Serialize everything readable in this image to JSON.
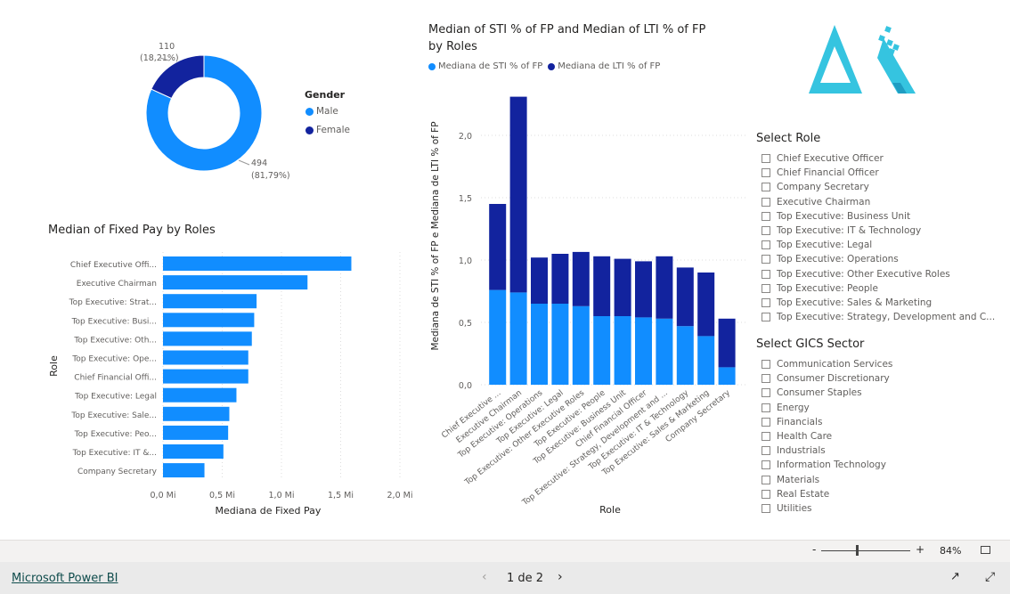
{
  "colors": {
    "sti": "#118dff",
    "lti": "#12239e",
    "male": "#118dff",
    "female": "#12239e",
    "logo": "#35c4e0"
  },
  "donut": {
    "legend_title": "Gender",
    "slices": [
      {
        "label": "Male",
        "value": 494,
        "pct_label": "494",
        "pct_sub": "(81,79%)",
        "pct": 81.79
      },
      {
        "label": "Female",
        "value": 110,
        "pct_label": "110",
        "pct_sub": "(18,21%)",
        "pct": 18.21
      }
    ]
  },
  "chart_data": [
    {
      "type": "bar",
      "orientation": "horizontal",
      "title": "Median of Fixed Pay by Roles",
      "xlabel": "Mediana de Fixed Pay",
      "ylabel": "Role",
      "xlim": [
        0,
        2.0
      ],
      "xticks": [
        "0,0 Mi",
        "0,5 Mi",
        "1,0 Mi",
        "1,5 Mi",
        "2,0 Mi"
      ],
      "categories": [
        "Chief Executive Offi...",
        "Executive Chairman",
        "Top Executive: Strat...",
        "Top Executive: Busi...",
        "Top Executive: Oth...",
        "Top Executive: Ope...",
        "Chief Financial Offi...",
        "Top Executive: Legal",
        "Top Executive: Sale...",
        "Top Executive: Peo...",
        "Top Executive: IT &...",
        "Company Secretary"
      ],
      "values": [
        1.59,
        1.22,
        0.79,
        0.77,
        0.75,
        0.72,
        0.72,
        0.62,
        0.56,
        0.55,
        0.51,
        0.35
      ],
      "unit": "Mi",
      "grid": true
    },
    {
      "type": "bar",
      "stacked": true,
      "title": "Median of STI % of FP and Median of LTI % of FP by Roles",
      "xlabel": "Role",
      "ylabel": "Mediana de STI % of FP e Mediana de LTI % of FP",
      "ylim": [
        0,
        2.3
      ],
      "yticks": [
        "0,0",
        "0,5",
        "1,0",
        "1,5",
        "2,0"
      ],
      "legend": "top-left",
      "categories": [
        "Chief Executive ...",
        "Executive Chairman",
        "Top Executive: Operations",
        "Top Executive: Legal",
        "Top Executive: Other Executive Roles",
        "Top Executive: People",
        "Top Executive: Business Unit",
        "Chief Financial Officer",
        "Top Executive: Strategy, Development and ...",
        "Top Executive: IT & Technology",
        "Top Executive: Sales & Marketing",
        "Company Secretary"
      ],
      "series": [
        {
          "name": "Mediana de STI % of FP",
          "values": [
            0.76,
            0.74,
            0.65,
            0.65,
            0.63,
            0.55,
            0.55,
            0.54,
            0.53,
            0.47,
            0.39,
            0.14
          ]
        },
        {
          "name": "Mediana de LTI % of FP",
          "values": [
            0.69,
            1.57,
            0.37,
            0.4,
            0.435,
            0.48,
            0.46,
            0.45,
            0.5,
            0.47,
            0.51,
            0.39
          ]
        }
      ],
      "grid": true
    }
  ],
  "role_slicer": {
    "title": "Select Role",
    "items": [
      "Chief Executive Officer",
      "Chief Financial Officer",
      "Company Secretary",
      "Executive Chairman",
      "Top Executive: Business Unit",
      "Top Executive: IT & Technology",
      "Top Executive: Legal",
      "Top Executive: Operations",
      "Top Executive: Other Executive Roles",
      "Top Executive: People",
      "Top Executive: Sales & Marketing",
      "Top Executive: Strategy, Development and C..."
    ]
  },
  "gics_slicer": {
    "title": "Select GICS Sector",
    "items": [
      "Communication Services",
      "Consumer Discretionary",
      "Consumer Staples",
      "Energy",
      "Financials",
      "Health Care",
      "Industrials",
      "Information Technology",
      "Materials",
      "Real Estate",
      "Utilities"
    ]
  },
  "zoom": {
    "minus": "-",
    "plus": "+",
    "level": "84%",
    "value": 84
  },
  "footer": {
    "brand": "Microsoft Power BI",
    "page": "1 de 2"
  }
}
